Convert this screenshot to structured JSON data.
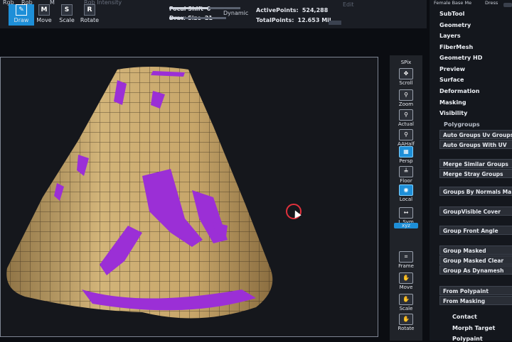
{
  "toolbar": {
    "top_labels": [
      "Rgb",
      "M",
      "Rgb Intensity"
    ],
    "tools": [
      {
        "label": "Draw",
        "icon": "✎"
      },
      {
        "label": "Move",
        "icon": "M"
      },
      {
        "label": "Scale",
        "icon": "S"
      },
      {
        "label": "Rotate",
        "icon": "R"
      }
    ],
    "focal_shift_label": "Focal Shift",
    "focal_shift_value": "0",
    "draw_size_label": "Draw Size",
    "draw_size_value": "21",
    "dynamic_label": "Dynamic",
    "active_points_label": "ActivePoints:",
    "active_points_value": "524,288",
    "total_points_label": "TotalPoints:",
    "total_points_value": "12.653 Mil",
    "edit_label": "Edit"
  },
  "header_right": {
    "text1": "Female Base Me",
    "text2": "Dress"
  },
  "shelf": [
    {
      "label": "SPix",
      "icon": ""
    },
    {
      "label": "Scroll",
      "icon": "✥"
    },
    {
      "label": "Zoom",
      "icon": "⚲"
    },
    {
      "label": "Actual",
      "icon": "⚲"
    },
    {
      "label": "AAHalf",
      "icon": "⚲"
    },
    {
      "label": "Persp",
      "icon": "▦"
    },
    {
      "label": "Floor",
      "icon": "╧"
    },
    {
      "label": "Local",
      "icon": "◉"
    },
    {
      "label": "L.Sym",
      "icon": "↔"
    },
    {
      "label": "xyz",
      "icon": ""
    },
    {
      "label": "Frame",
      "icon": "⌗"
    },
    {
      "label": "Move",
      "icon": "✋"
    },
    {
      "label": "Scale",
      "icon": "✋"
    },
    {
      "label": "Rotate",
      "icon": "✋"
    }
  ],
  "menu": [
    "SubTool",
    "Geometry",
    "Layers",
    "FiberMesh",
    "Geometry HD",
    "Preview",
    "Surface",
    "Deformation",
    "Masking",
    "Visibility",
    "Polygroups"
  ],
  "polygroups": [
    "Auto Groups Uv Groups",
    "Auto Groups With UV",
    "Merge Similar Groups",
    "Merge Stray Groups",
    "Groups By Normals  Ma",
    "GroupVisible  Cover",
    "Group Front  Angle",
    "Group Masked",
    "Group Masked Clear",
    "Group As Dynamesh",
    "From Polypaint",
    "From Masking"
  ],
  "menu_bottom": [
    "Contact",
    "Morph Target",
    "Polypaint"
  ],
  "colors": {
    "skirt": "#c9a86c",
    "mask": "#9b2fd6",
    "accent": "#1e8fd8"
  }
}
